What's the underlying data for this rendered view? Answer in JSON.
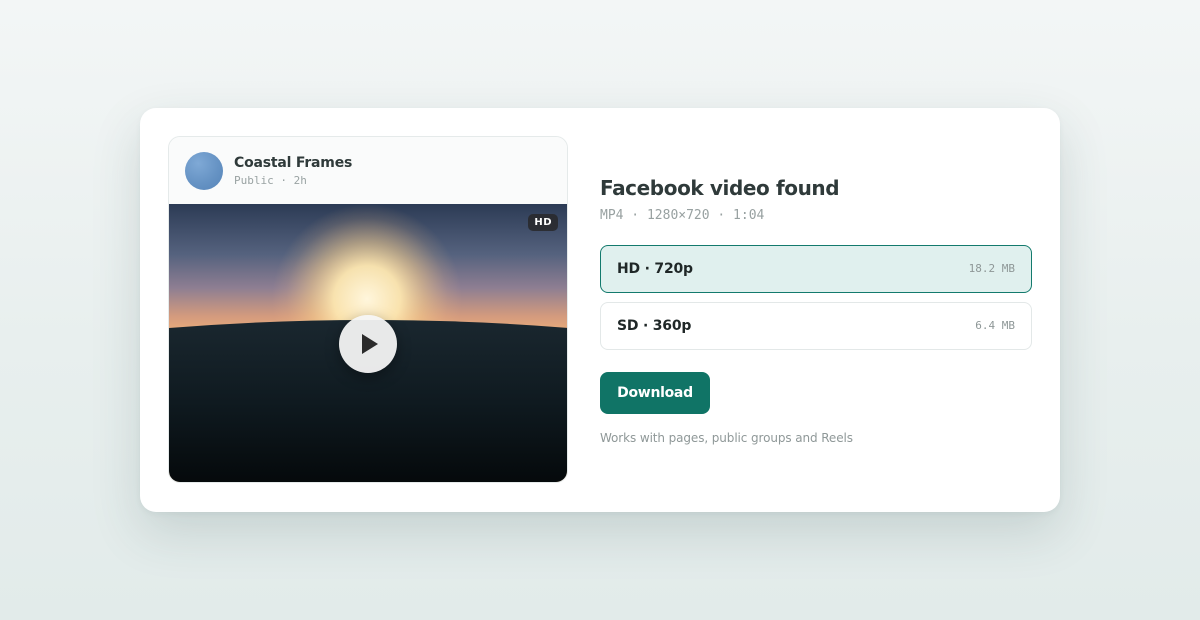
{
  "post": {
    "author": "Coastal Frames",
    "meta": "Public · 2h",
    "badge": "HD"
  },
  "result": {
    "title": "Facebook video found",
    "specs": "MP4 · 1280×720 · 1:04"
  },
  "options": [
    {
      "label": "HD · 720p",
      "size": "18.2 MB",
      "selected": true
    },
    {
      "label": "SD · 360p",
      "size": "6.4 MB",
      "selected": false
    }
  ],
  "actions": {
    "download_label": "Download"
  },
  "footnote": "Works with pages, public groups and Reels",
  "colors": {
    "accent": "#107466",
    "selected_bg": "#e0f0ee",
    "text_dark": "#2f3a3a",
    "text_muted": "#98a1a1"
  },
  "icons": {
    "play": "play-icon",
    "avatar": "avatar"
  }
}
